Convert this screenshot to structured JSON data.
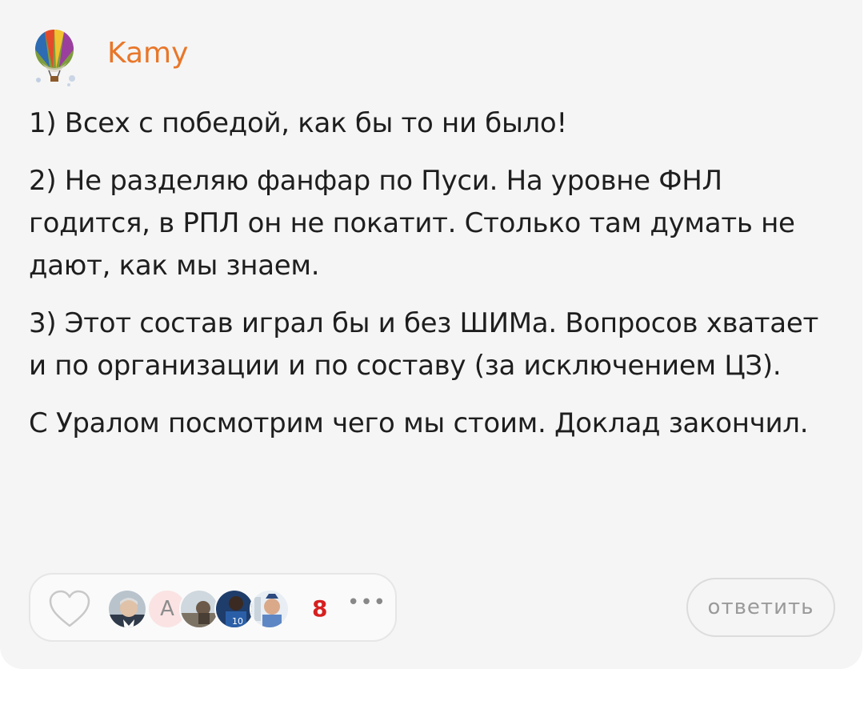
{
  "comment": {
    "author": {
      "name": "Kamy",
      "avatar_icon": "hot-air-balloon-icon"
    },
    "paragraphs": [
      "1) Всех с победой, как бы то ни было!",
      "2) Не разделяю фанфар по Пуси. На уровне ФНЛ годится, в РПЛ он не покатит. Столько там думать не дают, как мы знаем.",
      "3) Этот состав играл бы и без ШИМа. Вопросов хватает и по организации и по составу (за исключением ЦЗ).",
      "С Уралом посмотрим чего мы стоим. Доклад закончил."
    ]
  },
  "reactions": {
    "heart_icon": "heart-outline-icon",
    "reactor_letter": "A",
    "count": "8",
    "more_label": "•••"
  },
  "actions": {
    "reply_label": "ответить"
  },
  "colors": {
    "author": "#e8772a",
    "count": "#d62020",
    "card_bg": "#f5f5f5"
  }
}
